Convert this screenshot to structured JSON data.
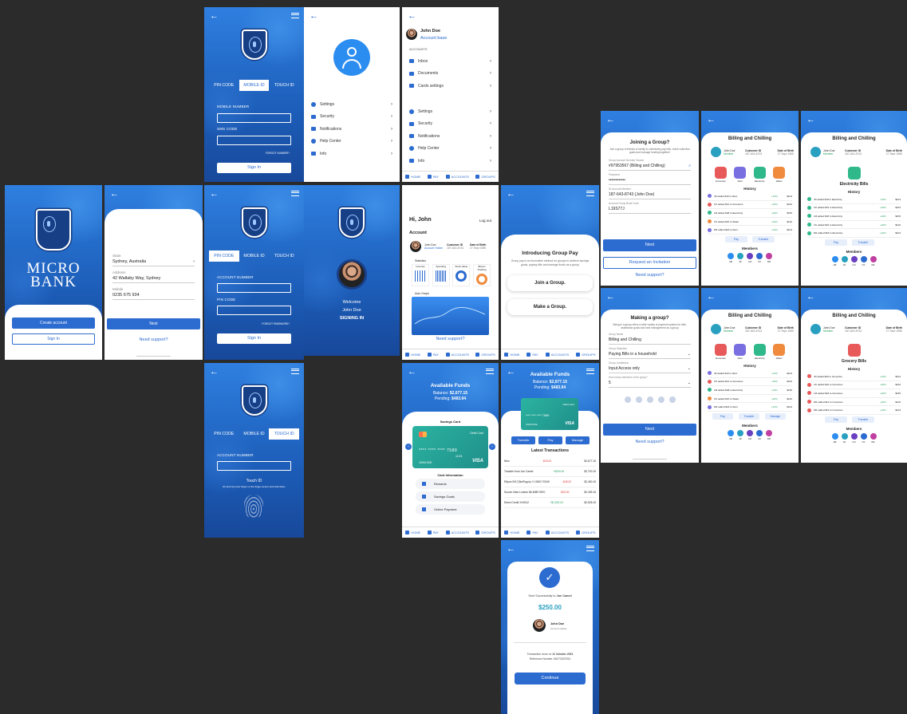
{
  "common": {
    "back": "←"
  },
  "login": {
    "tabs": [
      "PIN CODE",
      "MOBILE ID",
      "TOUCH ID"
    ],
    "mobile_label": "MOBILE NUMBER",
    "sms_label": "SMS CODE",
    "forgot_number": "FORGOT NUMBER?",
    "sign_in": "Sign In",
    "account_label": "ACCOUNT NUMBER",
    "pin_label": "PIN CODE",
    "forgot_password": "FORGOT PASSWORD?",
    "touch_title": "Touch ID",
    "touch_desc": "Lift and rest your finger on the finger sensor and hold down."
  },
  "profile_menu": {
    "items": [
      "Settings",
      "Security",
      "Notifications",
      "Help Center",
      "Info"
    ]
  },
  "account_menu": {
    "name": "John Doe",
    "sub": "Account base",
    "section": "ACCOUNTS",
    "items": [
      "Inbox",
      "Documents",
      "Cards settings"
    ],
    "items2": [
      "Settings",
      "Security",
      "Notifications",
      "Help Center",
      "Info"
    ]
  },
  "nav": [
    "HOME",
    "PAY",
    "ACCOUNTS",
    "GROUPS"
  ],
  "splash": {
    "brand1": "MICRO",
    "brand2": "BANK",
    "create": "Create account",
    "signin": "Sign In"
  },
  "register": {
    "state_label": "State",
    "state": "Sydney, Australia",
    "address_label": "Address",
    "address": "42 Wallaby Way, Sydney",
    "mobile_label": "Mobile",
    "mobile": "0235 675 934",
    "next": "Next",
    "support": "Need support?"
  },
  "signing": {
    "welcome": "Welcome",
    "name": "John Doe",
    "status": "SIGNING IN"
  },
  "home": {
    "greet": "Hi, John",
    "logout": "Log out",
    "section": "Account",
    "name": "John Doe",
    "account_holder": "Account Holder",
    "cust_label": "Customer ID",
    "cust": "187-643-8743",
    "dob_label": "Date of Birth",
    "dob": "27 Sept 1985",
    "stats": "Statistics",
    "stat_labels": [
      "Incomes",
      "Spending",
      "Stock Value",
      "Bitcoin Tracking"
    ],
    "graph": "Auto Graph",
    "support": "Need support?"
  },
  "group_intro": {
    "title": "Introducing Group Pay",
    "desc": "Group pay is an innovative method for groups to achieve savings goals, paying bills and manage funds as a group",
    "join": "Join a Group.",
    "make": "Make a Group."
  },
  "funds": {
    "title": "Available Funds",
    "balance_label": "Balance:",
    "balance": "$2,677.15",
    "pending_label": "Pending:",
    "pending": "$483.94",
    "savings": "Savings Card",
    "debit": "Debit Card",
    "card_no": "**** **** **** 7589",
    "holder": "JOHN DOE",
    "exp": "11/24",
    "visa": "VISA",
    "card_info": "Card Information",
    "info_items": [
      "Rewards",
      "Savings Goals",
      "Online Payment"
    ],
    "transfer": "Transfer",
    "pay": "Pay",
    "manage": "Manage",
    "latest": "Latest Transactions",
    "txs": [
      {
        "n": "Nino",
        "a": "-$23.00",
        "b": "$2,677.15"
      },
      {
        "n": "Transfer from Joe Camel",
        "a": "+$250.00",
        "b": "$2,700.15"
      },
      {
        "n": "Eftpos 0017(NetTopps) +1 0800 70349",
        "a": "-$45.00",
        "b": "$2,450.15"
      },
      {
        "n": "Sucom Data London 86-6089 9670",
        "a": "-$33.00",
        "b": "$2,495.15"
      },
      {
        "n": "Direct Credit XX4912",
        "a": "+$1,532.00",
        "b": "$2,528.15"
      }
    ]
  },
  "sent": {
    "text": "Sent Successfully to",
    "to": "Joe Camel",
    "amount": "$250.00",
    "name": "John Doe",
    "role": "Account Holder",
    "date_text": "Transaction done on",
    "date": "11 October 2021",
    "ref": "Reference Number: 56273037924",
    "continue": "Continue"
  },
  "join": {
    "title": "Joining a Group?",
    "desc": "Join a group of friends or family to collectively pay bills, reach collective goals and manage funding together!",
    "gid_label": "Group Account Number Search",
    "gid": "#97953567 (Billing and Chilling)",
    "pw_label": "Password",
    "pw": "••••••••••••",
    "mem_label": "ID Account Member",
    "mem": "187-643-8743 (John Doe)",
    "code_label": "Account Group Build Code",
    "code": "L19S77J",
    "next": "Next",
    "invite": "Request an Invitation",
    "support": "Need support?"
  },
  "make": {
    "title": "Making a group?",
    "desc": "Being in a group offers a wide variety of payment options for bills, assets/sav goals and fund management as a group",
    "name_label": "Group Name",
    "name": "Billing and Chilling",
    "obj_label": "Group Objective",
    "obj": "Paying Bills in a household",
    "lim_label": "Group Limitations",
    "lim": "Input Access only",
    "cnt_label": "How many members in the group?",
    "cnt": "5",
    "next": "Next",
    "support": "Need support?"
  },
  "billing": {
    "title": "Billing and Chilling",
    "name": "John Doe",
    "role": "Member",
    "cust_label": "Customer ID",
    "cust": "187-643-8743",
    "dob_label": "Date of Birth",
    "dob": "27 Sept 1985",
    "bills": [
      "Groceries",
      "Rent",
      "Electricity",
      "Water"
    ],
    "history": "History",
    "elec": "Electricity Bills",
    "groc": "Grocery Bills",
    "pay": "Pay",
    "transfer": "Transfer",
    "manage": "Manage",
    "members": "Members",
    "mem_initials": [
      "AB",
      "JD",
      "LM",
      "CK",
      "DR"
    ],
    "hist": [
      "JD added $10 to Rent",
      "CK added $12 to Groceries",
      "LM added $38 to Electricity",
      "CK added $15 to Water",
      "DR added $23 to Rent"
    ],
    "hist_pct": [
      "+10%",
      "+20%",
      "+20%",
      "+20%",
      "+10%"
    ],
    "hist_val": [
      "$104",
      "$210",
      "$156",
      "$126",
      "$104"
    ],
    "elec_hist": [
      "JD added $18 to Electricity",
      "CK added $19 to Electricity",
      "LM added $18 to Electricity",
      "CK added $15 to Electricity",
      "DR added $18 to Electricity"
    ],
    "groc_hist": [
      "JD added $20 to Groceries",
      "CK added $22 to Groceries",
      "LM added $18 to Groceries",
      "DR added $12 to Groceries",
      "DR added $15 to Groceries"
    ]
  }
}
